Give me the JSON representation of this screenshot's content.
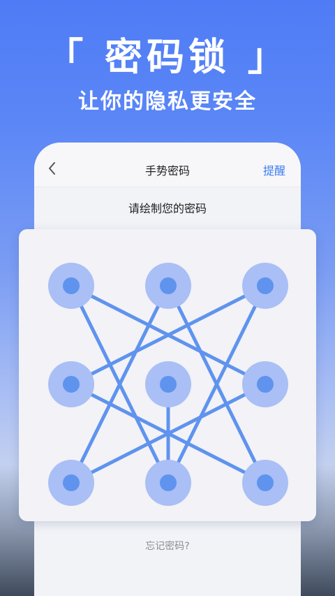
{
  "hero": {
    "title": "「 密码锁 」",
    "subtitle": "让你的隐私更安全"
  },
  "nav": {
    "back_icon": "chevron-left-icon",
    "title": "手势密码",
    "action_label": "提醒"
  },
  "prompt": "请绘制您的密码",
  "forgot_label": "忘记密码?",
  "colors": {
    "accent": "#3d7ef2",
    "node_outer": "#a9bff5",
    "node_inner": "#5f93ee",
    "pattern_line": "#5f93ee"
  },
  "pattern": {
    "grid": "3x3",
    "connections": [
      [
        1,
        6
      ],
      [
        1,
        8
      ],
      [
        3,
        4
      ],
      [
        3,
        8
      ],
      [
        7,
        2
      ],
      [
        7,
        6
      ],
      [
        9,
        2
      ],
      [
        9,
        4
      ],
      [
        5,
        8
      ]
    ]
  }
}
